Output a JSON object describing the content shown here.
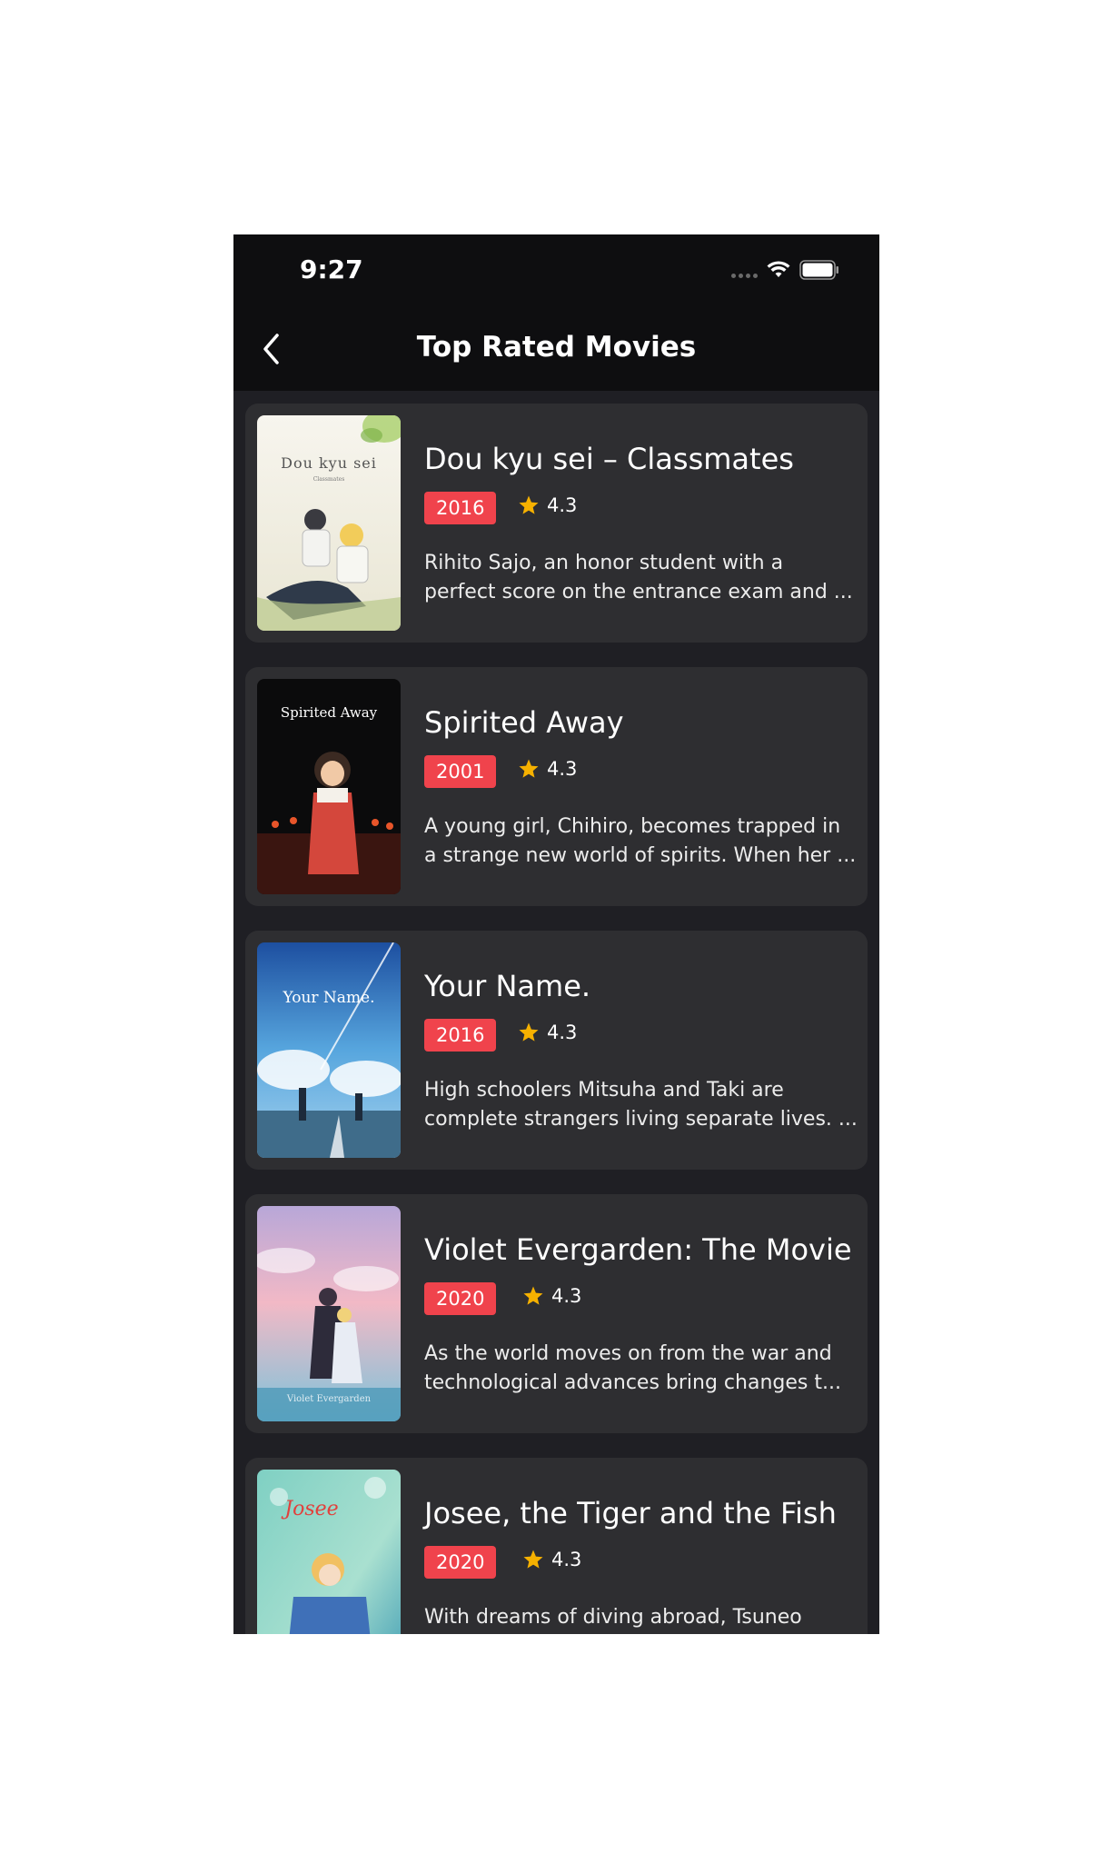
{
  "status_bar": {
    "time": "9:27"
  },
  "nav": {
    "title": "Top Rated Movies",
    "back_icon": "chevron-left-icon"
  },
  "colors": {
    "background": "#1f1f24",
    "card": "#2e2e31",
    "header": "#0e0e10",
    "badge": "#f0434c",
    "star": "#f6b100"
  },
  "movies": [
    {
      "title": "Dou kyu sei – Classmates",
      "year": "2016",
      "rating": "4.3",
      "description_line1": "Rihito Sajo, an honor student with a",
      "description_line2": "perfect score on the entrance exam and ...",
      "poster_text": "Dou kyu sei",
      "poster_subtext": "Classmates"
    },
    {
      "title": "Spirited Away",
      "year": "2001",
      "rating": "4.3",
      "description_line1": "A young girl, Chihiro, becomes trapped in",
      "description_line2": "a strange new world of spirits. When her ...",
      "poster_text": "Spirited Away"
    },
    {
      "title": "Your Name.",
      "year": "2016",
      "rating": "4.3",
      "description_line1": "High schoolers Mitsuha and Taki are",
      "description_line2": "complete strangers living separate lives. ...",
      "poster_text": "Your Name."
    },
    {
      "title": "Violet Evergarden: The Movie",
      "year": "2020",
      "rating": "4.3",
      "description_line1": "As the world moves on from the war and",
      "description_line2": "technological advances bring changes t...",
      "poster_text": "Violet Evergarden"
    },
    {
      "title": "Josee, the Tiger and the Fish",
      "year": "2020",
      "rating": "4.3",
      "description_line1": "With dreams of diving abroad, Tsuneo",
      "description_line2": "",
      "poster_text": "Josee"
    }
  ]
}
